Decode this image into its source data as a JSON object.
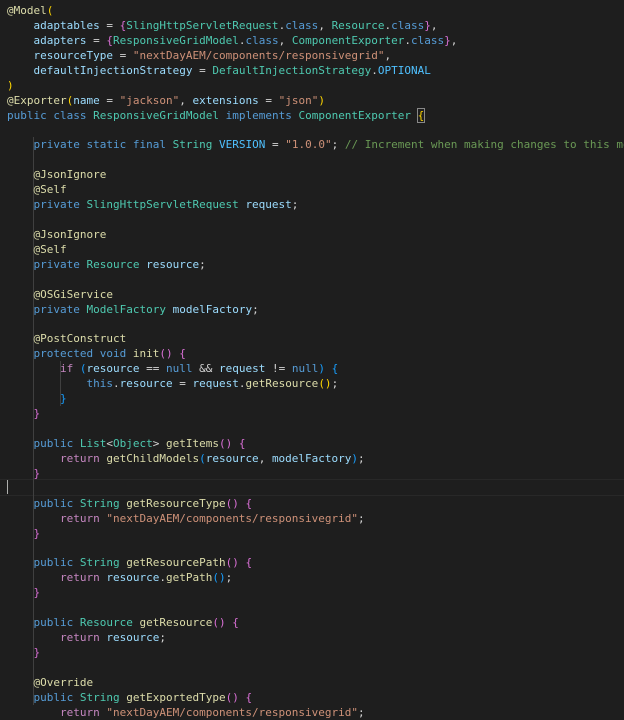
{
  "editor": {
    "language": "java",
    "theme": "dark",
    "lines": [
      [
        [
          "ann",
          "@"
        ],
        [
          "ann",
          "Model"
        ],
        [
          "br1",
          "("
        ]
      ],
      [
        [
          "txt",
          "    "
        ],
        [
          "prop",
          "adaptables"
        ],
        [
          "txt",
          " = "
        ],
        [
          "br2",
          "{"
        ],
        [
          "type",
          "SlingHttpServletRequest"
        ],
        [
          "txt",
          "."
        ],
        [
          "kw",
          "class"
        ],
        [
          "txt",
          ", "
        ],
        [
          "type",
          "Resource"
        ],
        [
          "txt",
          "."
        ],
        [
          "kw",
          "class"
        ],
        [
          "br2",
          "}"
        ],
        [
          "txt",
          ","
        ]
      ],
      [
        [
          "txt",
          "    "
        ],
        [
          "prop",
          "adapters"
        ],
        [
          "txt",
          " = "
        ],
        [
          "br2",
          "{"
        ],
        [
          "type",
          "ResponsiveGridModel"
        ],
        [
          "txt",
          "."
        ],
        [
          "kw",
          "class"
        ],
        [
          "txt",
          ", "
        ],
        [
          "type",
          "ComponentExporter"
        ],
        [
          "txt",
          "."
        ],
        [
          "kw",
          "class"
        ],
        [
          "br2",
          "}"
        ],
        [
          "txt",
          ","
        ]
      ],
      [
        [
          "txt",
          "    "
        ],
        [
          "prop",
          "resourceType"
        ],
        [
          "txt",
          " = "
        ],
        [
          "str",
          "\"nextDayAEM/components/responsivegrid\""
        ],
        [
          "txt",
          ","
        ]
      ],
      [
        [
          "txt",
          "    "
        ],
        [
          "prop",
          "defaultInjectionStrategy"
        ],
        [
          "txt",
          " = "
        ],
        [
          "type",
          "DefaultInjectionStrategy"
        ],
        [
          "txt",
          "."
        ],
        [
          "const",
          "OPTIONAL"
        ]
      ],
      [
        [
          "br1",
          ")"
        ]
      ],
      [
        [
          "ann",
          "@"
        ],
        [
          "ann",
          "Exporter"
        ],
        [
          "br1",
          "("
        ],
        [
          "prop",
          "name"
        ],
        [
          "txt",
          " = "
        ],
        [
          "str",
          "\"jackson\""
        ],
        [
          "txt",
          ", "
        ],
        [
          "prop",
          "extensions"
        ],
        [
          "txt",
          " = "
        ],
        [
          "str",
          "\"json\""
        ],
        [
          "br1",
          ")"
        ]
      ],
      [
        [
          "kw",
          "public"
        ],
        [
          "txt",
          " "
        ],
        [
          "kw",
          "class"
        ],
        [
          "txt",
          " "
        ],
        [
          "type",
          "ResponsiveGridModel"
        ],
        [
          "txt",
          " "
        ],
        [
          "kw",
          "implements"
        ],
        [
          "txt",
          " "
        ],
        [
          "type",
          "ComponentExporter"
        ],
        [
          "txt",
          " "
        ],
        [
          "br1m",
          "{"
        ]
      ],
      [],
      [
        [
          "txt",
          "    "
        ],
        [
          "kw",
          "private"
        ],
        [
          "txt",
          " "
        ],
        [
          "kw",
          "static"
        ],
        [
          "txt",
          " "
        ],
        [
          "kw",
          "final"
        ],
        [
          "txt",
          " "
        ],
        [
          "type",
          "String"
        ],
        [
          "txt",
          " "
        ],
        [
          "const",
          "VERSION"
        ],
        [
          "txt",
          " = "
        ],
        [
          "str",
          "\"1.0.0\""
        ],
        [
          "txt",
          "; "
        ],
        [
          "cmt",
          "// Increment when making changes to this model"
        ]
      ],
      [],
      [
        [
          "txt",
          "    "
        ],
        [
          "ann",
          "@"
        ],
        [
          "ann",
          "JsonIgnore"
        ]
      ],
      [
        [
          "txt",
          "    "
        ],
        [
          "ann",
          "@"
        ],
        [
          "ann",
          "Self"
        ]
      ],
      [
        [
          "txt",
          "    "
        ],
        [
          "kw",
          "private"
        ],
        [
          "txt",
          " "
        ],
        [
          "type",
          "SlingHttpServletRequest"
        ],
        [
          "txt",
          " "
        ],
        [
          "prop",
          "request"
        ],
        [
          "txt",
          ";"
        ]
      ],
      [],
      [
        [
          "txt",
          "    "
        ],
        [
          "ann",
          "@"
        ],
        [
          "ann",
          "JsonIgnore"
        ]
      ],
      [
        [
          "txt",
          "    "
        ],
        [
          "ann",
          "@"
        ],
        [
          "ann",
          "Self"
        ]
      ],
      [
        [
          "txt",
          "    "
        ],
        [
          "kw",
          "private"
        ],
        [
          "txt",
          " "
        ],
        [
          "type",
          "Resource"
        ],
        [
          "txt",
          " "
        ],
        [
          "prop",
          "resource"
        ],
        [
          "txt",
          ";"
        ]
      ],
      [],
      [
        [
          "txt",
          "    "
        ],
        [
          "ann",
          "@"
        ],
        [
          "ann",
          "OSGiService"
        ]
      ],
      [
        [
          "txt",
          "    "
        ],
        [
          "kw",
          "private"
        ],
        [
          "txt",
          " "
        ],
        [
          "type",
          "ModelFactory"
        ],
        [
          "txt",
          " "
        ],
        [
          "prop",
          "modelFactory"
        ],
        [
          "txt",
          ";"
        ]
      ],
      [],
      [
        [
          "txt",
          "    "
        ],
        [
          "ann",
          "@"
        ],
        [
          "ann",
          "PostConstruct"
        ]
      ],
      [
        [
          "txt",
          "    "
        ],
        [
          "kw",
          "protected"
        ],
        [
          "txt",
          " "
        ],
        [
          "kw",
          "void"
        ],
        [
          "txt",
          " "
        ],
        [
          "fn",
          "init"
        ],
        [
          "br2",
          "()"
        ],
        [
          "txt",
          " "
        ],
        [
          "br2",
          "{"
        ]
      ],
      [
        [
          "txt",
          "        "
        ],
        [
          "ctl",
          "if"
        ],
        [
          "txt",
          " "
        ],
        [
          "br3",
          "("
        ],
        [
          "prop",
          "resource"
        ],
        [
          "txt",
          " == "
        ],
        [
          "kw",
          "null"
        ],
        [
          "txt",
          " && "
        ],
        [
          "prop",
          "request"
        ],
        [
          "txt",
          " != "
        ],
        [
          "kw",
          "null"
        ],
        [
          "br3",
          ")"
        ],
        [
          "txt",
          " "
        ],
        [
          "br3",
          "{"
        ]
      ],
      [
        [
          "txt",
          "            "
        ],
        [
          "kw",
          "this"
        ],
        [
          "txt",
          "."
        ],
        [
          "prop",
          "resource"
        ],
        [
          "txt",
          " = "
        ],
        [
          "prop",
          "request"
        ],
        [
          "txt",
          "."
        ],
        [
          "fn",
          "getResource"
        ],
        [
          "br1",
          "()"
        ],
        [
          "txt",
          ";"
        ]
      ],
      [
        [
          "txt",
          "        "
        ],
        [
          "br3",
          "}"
        ]
      ],
      [
        [
          "txt",
          "    "
        ],
        [
          "br2",
          "}"
        ]
      ],
      [],
      [
        [
          "txt",
          "    "
        ],
        [
          "kw",
          "public"
        ],
        [
          "txt",
          " "
        ],
        [
          "type",
          "List"
        ],
        [
          "txt",
          "<"
        ],
        [
          "type",
          "Object"
        ],
        [
          "txt",
          "> "
        ],
        [
          "fn",
          "getItems"
        ],
        [
          "br2",
          "()"
        ],
        [
          "txt",
          " "
        ],
        [
          "br2",
          "{"
        ]
      ],
      [
        [
          "txt",
          "        "
        ],
        [
          "ctl",
          "return"
        ],
        [
          "txt",
          " "
        ],
        [
          "fn",
          "getChildModels"
        ],
        [
          "br3",
          "("
        ],
        [
          "prop",
          "resource"
        ],
        [
          "txt",
          ", "
        ],
        [
          "prop",
          "modelFactory"
        ],
        [
          "br3",
          ")"
        ],
        [
          "txt",
          ";"
        ]
      ],
      [
        [
          "txt",
          "    "
        ],
        [
          "br2",
          "}"
        ]
      ],
      [],
      [
        [
          "txt",
          "    "
        ],
        [
          "kw",
          "public"
        ],
        [
          "txt",
          " "
        ],
        [
          "type",
          "String"
        ],
        [
          "txt",
          " "
        ],
        [
          "fn",
          "getResourceType"
        ],
        [
          "br2",
          "()"
        ],
        [
          "txt",
          " "
        ],
        [
          "br2",
          "{"
        ]
      ],
      [
        [
          "txt",
          "        "
        ],
        [
          "ctl",
          "return"
        ],
        [
          "txt",
          " "
        ],
        [
          "str",
          "\"nextDayAEM/components/responsivegrid\""
        ],
        [
          "txt",
          ";"
        ]
      ],
      [
        [
          "txt",
          "    "
        ],
        [
          "br2",
          "}"
        ]
      ],
      [],
      [
        [
          "txt",
          "    "
        ],
        [
          "kw",
          "public"
        ],
        [
          "txt",
          " "
        ],
        [
          "type",
          "String"
        ],
        [
          "txt",
          " "
        ],
        [
          "fn",
          "getResourcePath"
        ],
        [
          "br2",
          "()"
        ],
        [
          "txt",
          " "
        ],
        [
          "br2",
          "{"
        ]
      ],
      [
        [
          "txt",
          "        "
        ],
        [
          "ctl",
          "return"
        ],
        [
          "txt",
          " "
        ],
        [
          "prop",
          "resource"
        ],
        [
          "txt",
          "."
        ],
        [
          "fn",
          "getPath"
        ],
        [
          "br3",
          "()"
        ],
        [
          "txt",
          ";"
        ]
      ],
      [
        [
          "txt",
          "    "
        ],
        [
          "br2",
          "}"
        ]
      ],
      [],
      [
        [
          "txt",
          "    "
        ],
        [
          "kw",
          "public"
        ],
        [
          "txt",
          " "
        ],
        [
          "type",
          "Resource"
        ],
        [
          "txt",
          " "
        ],
        [
          "fn",
          "getResource"
        ],
        [
          "br2",
          "()"
        ],
        [
          "txt",
          " "
        ],
        [
          "br2",
          "{"
        ]
      ],
      [
        [
          "txt",
          "        "
        ],
        [
          "ctl",
          "return"
        ],
        [
          "txt",
          " "
        ],
        [
          "prop",
          "resource"
        ],
        [
          "txt",
          ";"
        ]
      ],
      [
        [
          "txt",
          "    "
        ],
        [
          "br2",
          "}"
        ]
      ],
      [],
      [
        [
          "txt",
          "    "
        ],
        [
          "ann",
          "@"
        ],
        [
          "ann",
          "Override"
        ]
      ],
      [
        [
          "txt",
          "    "
        ],
        [
          "kw",
          "public"
        ],
        [
          "txt",
          " "
        ],
        [
          "type",
          "String"
        ],
        [
          "txt",
          " "
        ],
        [
          "fn",
          "getExportedType"
        ],
        [
          "br2",
          "()"
        ],
        [
          "txt",
          " "
        ],
        [
          "br2",
          "{"
        ]
      ],
      [
        [
          "txt",
          "        "
        ],
        [
          "ctl",
          "return"
        ],
        [
          "txt",
          " "
        ],
        [
          "str",
          "\"nextDayAEM/components/responsivegrid\""
        ],
        [
          "txt",
          ";"
        ]
      ]
    ]
  }
}
